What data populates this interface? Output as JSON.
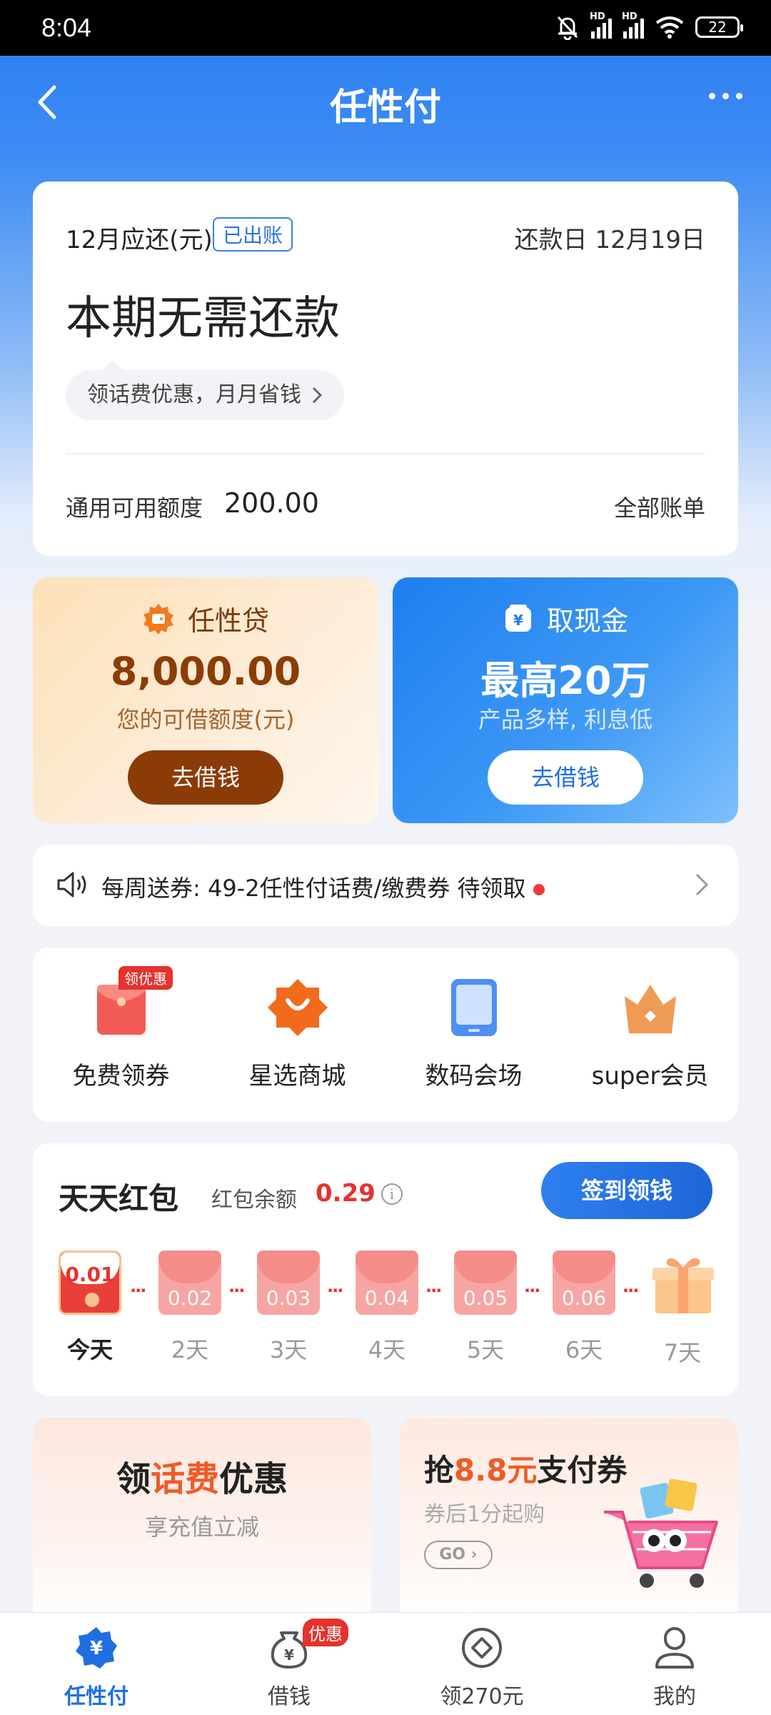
{
  "status_bar": {
    "time": "8:04",
    "battery": "22",
    "hd1": "HD",
    "hd2": "HD"
  },
  "nav": {
    "title": "任性付"
  },
  "bill": {
    "month_label": "12月应还(元)",
    "status_badge": "已出账",
    "due_date": "还款日 12月19日",
    "main_message": "本期无需还款",
    "promo": "领话费优惠，月月省钱",
    "limit_label": "通用可用额度",
    "limit_value": "200.00",
    "all_bills": "全部账单"
  },
  "loan_card": {
    "title": "任性贷",
    "amount": "8,000.00",
    "subtitle": "您的可借额度(元)",
    "button": "去借钱"
  },
  "cash_card": {
    "title": "取现金",
    "amount": "最高20万",
    "subtitle": "产品多样, 利息低",
    "button": "去借钱"
  },
  "notice": {
    "text": "每周送券:  49-2任性付话费/缴费券 待领取"
  },
  "quick_links": {
    "tag": "领优惠",
    "items": [
      {
        "label": "免费领券",
        "icon": "red-envelope-icon"
      },
      {
        "label": "星选商城",
        "icon": "shopping-bag-icon"
      },
      {
        "label": "数码会场",
        "icon": "tablet-icon"
      },
      {
        "label": "super会员",
        "icon": "crown-icon"
      }
    ]
  },
  "red_packet": {
    "title": "天天红包",
    "balance_label": "红包余额",
    "balance_value": "0.29",
    "info_icon": "i",
    "button": "签到领钱",
    "days": [
      {
        "value": "0.01",
        "label": "今天"
      },
      {
        "value": "0.02",
        "label": "2天"
      },
      {
        "value": "0.03",
        "label": "3天"
      },
      {
        "value": "0.04",
        "label": "4天"
      },
      {
        "value": "0.05",
        "label": "5天"
      },
      {
        "value": "0.06",
        "label": "6天"
      },
      {
        "value": "",
        "label": "7天"
      }
    ]
  },
  "promo_left": {
    "title_a": "领",
    "title_hl": "话费",
    "title_b": "优惠",
    "subtitle": "享充值立减"
  },
  "promo_right": {
    "title_a": "抢",
    "title_hl": "8.8元",
    "title_b": "支付券",
    "subtitle": "券后1分起购",
    "go": "GO"
  },
  "tabbar": {
    "badge": "优惠",
    "items": [
      {
        "label": "任性付",
        "icon": "yuan-shield-icon"
      },
      {
        "label": "借钱",
        "icon": "money-bag-icon"
      },
      {
        "label": "领270元",
        "icon": "diamond-coin-icon"
      },
      {
        "label": "我的",
        "icon": "person-icon"
      }
    ]
  },
  "colors": {
    "accent_blue": "#1f6fe0",
    "loan_brown": "#8b3b06",
    "red": "#e5322d",
    "orange": "#f05a28"
  }
}
